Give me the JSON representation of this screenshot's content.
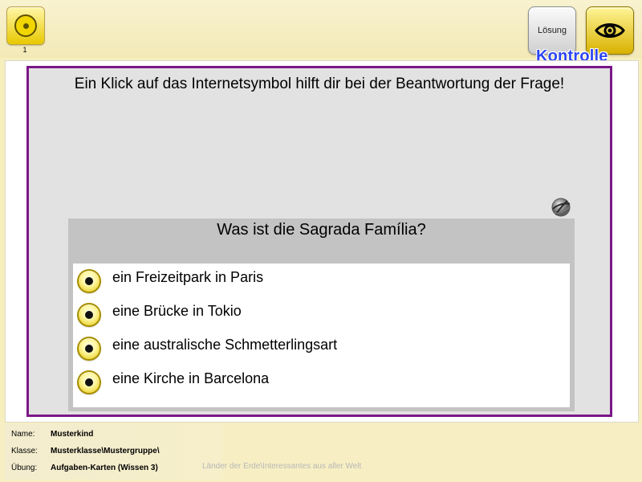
{
  "header": {
    "page_number": "1",
    "solution_label": "Lösung",
    "kontrolle_label": "Kontrolle"
  },
  "content": {
    "instruction": "Ein Klick auf das Internetsymbol hilft dir bei der Beantwortung der Frage!",
    "question": "Was ist die Sagrada Família?",
    "answers": [
      "ein Freizeitpark in Paris",
      "eine Brücke in Tokio",
      "eine australische Schmetterlingsart",
      "eine Kirche in Barcelona"
    ]
  },
  "footer": {
    "name_label": "Name:",
    "name_value": "Musterkind",
    "class_label": "Klasse:",
    "class_value": "Musterklasse\\Mustergruppe\\",
    "exercise_label": "Übung:",
    "exercise_value": "Aufgaben-Karten (Wissen 3)",
    "path": "Länder der Erde\\Interessantes aus aller Welt"
  },
  "icons": {
    "app_icon": "yellow-circle-icon",
    "eye_icon": "eye-icon",
    "internet_icon": "internet-icon",
    "radio_icon": "radio-button-icon"
  },
  "colors": {
    "accent_purple": "#7b1787",
    "accent_yellow": "#f1d600",
    "blue_label": "#2d46f4",
    "background": "#f6eebd"
  }
}
